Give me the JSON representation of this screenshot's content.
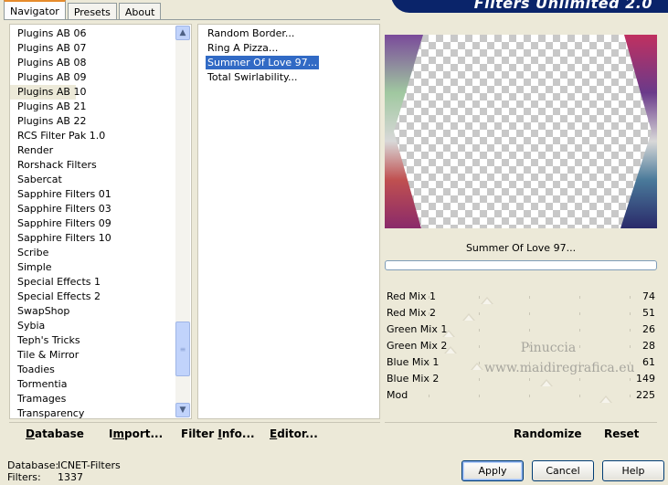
{
  "banner": {
    "title": "Filters Unlimited 2.0"
  },
  "tabs": [
    {
      "label": "Navigator",
      "active": true
    },
    {
      "label": "Presets",
      "active": false
    },
    {
      "label": "About",
      "active": false
    }
  ],
  "categories": {
    "items": [
      "Plugins AB 06",
      "Plugins AB 07",
      "Plugins AB 08",
      "Plugins AB 09",
      "Plugins AB 10",
      "Plugins AB 21",
      "Plugins AB 22",
      "RCS Filter Pak 1.0",
      "Render",
      "Rorshack Filters",
      "Sabercat",
      "Sapphire Filters 01",
      "Sapphire Filters 03",
      "Sapphire Filters 09",
      "Sapphire Filters 10",
      "Scribe",
      "Simple",
      "Special Effects 1",
      "Special Effects 2",
      "SwapShop",
      "Sybia",
      "Teph's Tricks",
      "Tile & Mirror",
      "Toadies",
      "Tormentia",
      "Tramages",
      "Transparency"
    ],
    "selected_index": 4
  },
  "filters": {
    "items": [
      "Random Border...",
      "Ring A Pizza...",
      "Summer Of Love 97...",
      "Total Swirlability..."
    ],
    "selected_index": 2
  },
  "preview": {
    "filter_name": "Summer Of Love 97..."
  },
  "sliders": [
    {
      "label": "Red Mix 1",
      "value": "74",
      "level": 74
    },
    {
      "label": "Red Mix 2",
      "value": "51",
      "level": 51
    },
    {
      "label": "Green Mix 1",
      "value": "26",
      "level": 26
    },
    {
      "label": "Green Mix 2",
      "value": "28",
      "level": 28
    },
    {
      "label": "Blue Mix 1",
      "value": "61",
      "level": 61
    },
    {
      "label": "Blue Mix 2",
      "value": "149",
      "level": 149
    },
    {
      "label": "Mod",
      "value": "225",
      "level": 225
    }
  ],
  "watermark": {
    "line1": "Pinuccia",
    "line2": "www.maidiregrafica.eu"
  },
  "left_toolbar": {
    "database": {
      "accel": "D",
      "rest": "atabase"
    },
    "import": {
      "pre": "I",
      "accel": "m",
      "rest": "port..."
    },
    "filter_info": {
      "pre": "Filter ",
      "accel": "I",
      "rest": "nfo..."
    },
    "editor": {
      "accel": "E",
      "rest": "ditor..."
    }
  },
  "right_toolbar": {
    "randomize": "Randomize",
    "reset": "Reset"
  },
  "status": {
    "database_label": "Database:",
    "database_value": "ICNET-Filters",
    "filters_label": "Filters:",
    "filters_value": "1337"
  },
  "buttons": {
    "apply": "Apply",
    "cancel": "Cancel",
    "help": "Help"
  },
  "scroll_icons": {
    "up": "arrow-up-icon",
    "down": "arrow-down-icon",
    "grip": "grip-icon"
  }
}
